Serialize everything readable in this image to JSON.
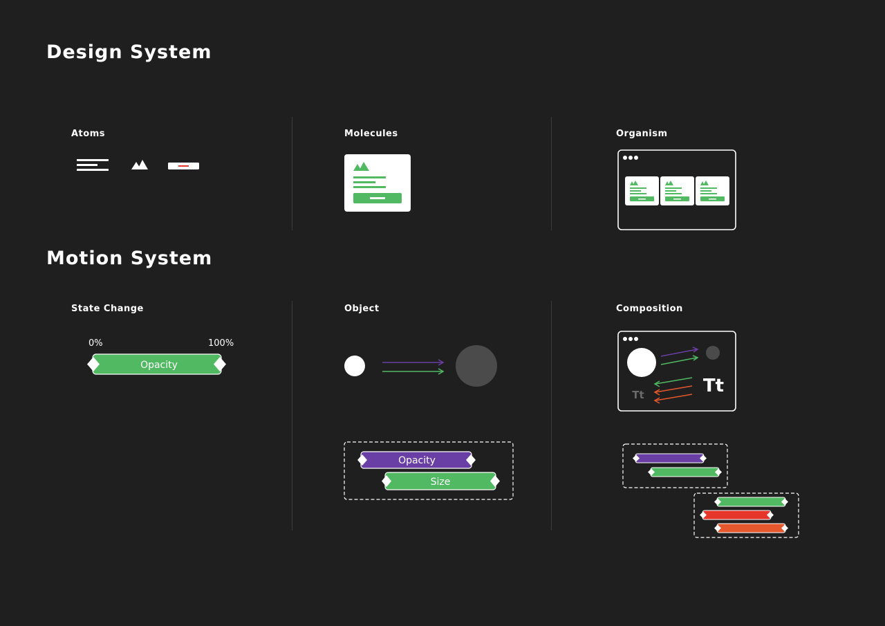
{
  "design_system": {
    "title": "Design System",
    "columns": {
      "atoms": "Atoms",
      "molecules": "Molecules",
      "organism": "Organism"
    }
  },
  "motion_system": {
    "title": "Motion System",
    "columns": {
      "state_change": "State Change",
      "object": "Object",
      "composition": "Composition"
    },
    "state_change": {
      "start_label": "0%",
      "end_label": "100%",
      "track_label": "Opacity"
    },
    "object": {
      "tracks": [
        "Opacity",
        "Size"
      ]
    },
    "composition": {
      "type_glyph": "Tt"
    }
  },
  "colors": {
    "background": "#1f1f1f",
    "green": "#52b963",
    "purple": "#6a3fa5",
    "red": "#e6362b",
    "orange": "#e5582e",
    "divider": "#3c3c3c",
    "gray_circle": "#4b4b4b"
  }
}
